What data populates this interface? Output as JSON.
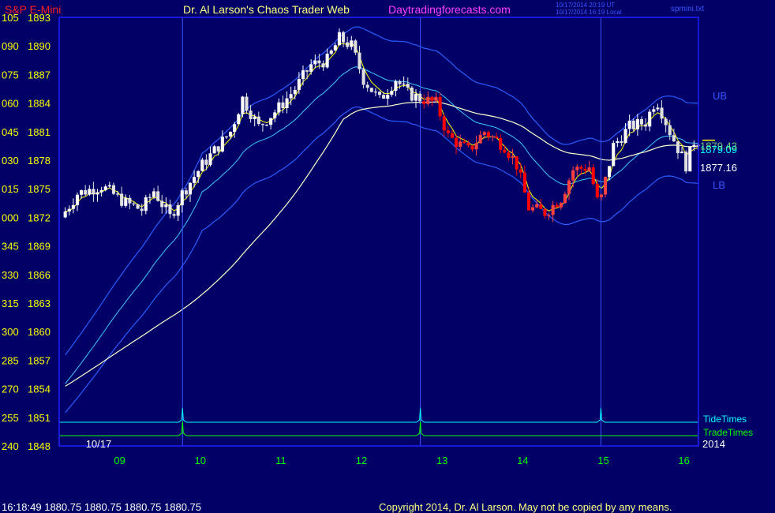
{
  "header": {
    "symbol": "S&P E-Mini",
    "title": "Dr. Al Larson's Chaos Trader Web",
    "site": "Daytradingforecasts.com",
    "timestamp_ut": "10/17/2014 20:19 UT",
    "timestamp_local": "10/17/2014 16:19 Local",
    "file": "spmini.txt"
  },
  "footer": {
    "last_quote": "16:18:49  1880.75  1880.75  1880.75  1880.75",
    "copyright": "Copyright 2014, Dr. Al Larson. May not be copied by any means."
  },
  "colors": {
    "background": "#000066",
    "frame": "#2020ff",
    "up_candle": "#ffffff",
    "down_candle": "#ff0000",
    "tide_times": "#00ffff",
    "trade_times": "#00ff00",
    "fast_ma": "#ffff00",
    "slow_ma": "#ffffcc",
    "band_inner": "#40c8ff",
    "band_outer": "#2a5cff"
  },
  "chart_data": {
    "type": "candlestick",
    "ylim": [
      1848,
      1893
    ],
    "y_ticks": [
      {
        "left": "105",
        "value": 1893
      },
      {
        "left": "090",
        "value": 1890
      },
      {
        "left": "075",
        "value": 1887
      },
      {
        "left": "060",
        "value": 1884
      },
      {
        "left": "045",
        "value": 1881
      },
      {
        "left": "030",
        "value": 1878
      },
      {
        "left": "015",
        "value": 1875
      },
      {
        "left": "000",
        "value": 1872
      },
      {
        "left": "345",
        "value": 1869
      },
      {
        "left": "330",
        "value": 1866
      },
      {
        "left": "315",
        "value": 1863
      },
      {
        "left": "300",
        "value": 1860
      },
      {
        "left": "285",
        "value": 1857
      },
      {
        "left": "270",
        "value": 1854
      },
      {
        "left": "255",
        "value": 1851
      },
      {
        "left": "240",
        "value": 1848
      }
    ],
    "xlim": [
      8.25,
      16.18
    ],
    "x_ticks": [
      {
        "label": "09",
        "value": 9
      },
      {
        "label": "10",
        "value": 10
      },
      {
        "label": "11",
        "value": 11
      },
      {
        "label": "12",
        "value": 12
      },
      {
        "label": "13",
        "value": 13
      },
      {
        "label": "14",
        "value": 14
      },
      {
        "label": "15",
        "value": 15
      },
      {
        "label": "16",
        "value": 16
      }
    ],
    "date_label": "10/17",
    "year_label": "2014",
    "vertical_markers": [
      9.78,
      12.73,
      14.97
    ],
    "tide_times": {
      "name": "TideTimes",
      "peaks": [
        9.78,
        12.73,
        14.97
      ]
    },
    "trade_times": {
      "name": "TradeTimes",
      "peaks": [
        9.78,
        12.73
      ]
    },
    "band_labels": {
      "upper": "UB",
      "lower": "LB"
    },
    "price_labels": [
      "1879.09",
      "1879.43",
      "1877.16"
    ],
    "price_label_values": [
      1879.09,
      1879.43,
      1877.16
    ],
    "candle_interval_hours": 0.05,
    "anchors": [
      {
        "x": 8.3,
        "y": 1872.0
      },
      {
        "x": 8.5,
        "y": 1874.5
      },
      {
        "x": 8.8,
        "y": 1875.3
      },
      {
        "x": 9.1,
        "y": 1873.5
      },
      {
        "x": 9.3,
        "y": 1872.8
      },
      {
        "x": 9.45,
        "y": 1874.8
      },
      {
        "x": 9.65,
        "y": 1872.0
      },
      {
        "x": 9.8,
        "y": 1874.5
      },
      {
        "x": 10.05,
        "y": 1877.5
      },
      {
        "x": 10.4,
        "y": 1881.0
      },
      {
        "x": 10.55,
        "y": 1884.5
      },
      {
        "x": 10.75,
        "y": 1881.5
      },
      {
        "x": 11.0,
        "y": 1883.5
      },
      {
        "x": 11.2,
        "y": 1885.5
      },
      {
        "x": 11.4,
        "y": 1888.0
      },
      {
        "x": 11.6,
        "y": 1888.5
      },
      {
        "x": 11.75,
        "y": 1890.8
      },
      {
        "x": 11.9,
        "y": 1890.0
      },
      {
        "x": 12.05,
        "y": 1886.5
      },
      {
        "x": 12.25,
        "y": 1884.3
      },
      {
        "x": 12.45,
        "y": 1886.5
      },
      {
        "x": 12.6,
        "y": 1885.0
      },
      {
        "x": 12.75,
        "y": 1884.5
      },
      {
        "x": 12.95,
        "y": 1884.0
      },
      {
        "x": 13.1,
        "y": 1880.5
      },
      {
        "x": 13.35,
        "y": 1879.0
      },
      {
        "x": 13.55,
        "y": 1881.0
      },
      {
        "x": 13.8,
        "y": 1879.5
      },
      {
        "x": 13.95,
        "y": 1877.5
      },
      {
        "x": 14.1,
        "y": 1873.0
      },
      {
        "x": 14.3,
        "y": 1872.5
      },
      {
        "x": 14.5,
        "y": 1874.0
      },
      {
        "x": 14.65,
        "y": 1877.0
      },
      {
        "x": 14.85,
        "y": 1877.3
      },
      {
        "x": 14.97,
        "y": 1873.0
      },
      {
        "x": 15.15,
        "y": 1879.5
      },
      {
        "x": 15.35,
        "y": 1881.5
      },
      {
        "x": 15.55,
        "y": 1882.0
      },
      {
        "x": 15.68,
        "y": 1884.5
      },
      {
        "x": 15.85,
        "y": 1881.0
      },
      {
        "x": 16.05,
        "y": 1877.5
      },
      {
        "x": 16.15,
        "y": 1880.0
      }
    ]
  }
}
